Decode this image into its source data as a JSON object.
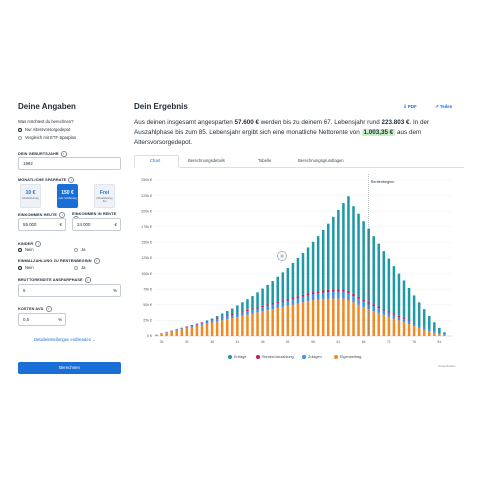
{
  "left": {
    "title": "Deine Angaben",
    "question": "Was möchtest du berechnen?",
    "options": [
      "Nur Altersvorsorgedepot",
      "Vergleich mit ETF-Sparplan"
    ],
    "birth_year_label": "DEIN GEBURTSJAHR",
    "birth_year": "1992",
    "savings_label": "MONATLICHE SPARRATE",
    "savings": [
      {
        "value": "10 €",
        "sub": "Mindestbetrag"
      },
      {
        "value": "150 €",
        "sub": "max. Förderung"
      },
      {
        "value": "Frei",
        "sub": "Monatsbetrag frei"
      }
    ],
    "income_today_label": "EINKOMMEN HEUTE",
    "income_today": "55.000",
    "income_future_label": "EINKOMMEN IN RENTE",
    "income_future": "24.000",
    "currency": "€",
    "children_label": "KINDER",
    "children_options": [
      "Nein",
      "Ja"
    ],
    "payout_label": "EINMALZAHLUNG ZU RENTENBEGINN",
    "payout_options": [
      "Nein",
      "Ja"
    ],
    "return_label": "BRUTTORENDITE ANSPARPHASE",
    "return_value": "6",
    "percent": "%",
    "costs_label": "KOSTEN AVD",
    "costs_value": "0,5",
    "detail_link": "Detaileinstellungen einblenden",
    "calc_button": "Berechnen"
  },
  "right": {
    "title": "Dein Ergebnis",
    "pdf": "PDF",
    "share": "Teilen",
    "summary_parts": [
      "Aus deinen insgesamt angesparten ",
      "57.600 €",
      " werden bis zu deinem 67. Lebensjahr rund ",
      "223.803 €",
      ". In der Auszahlphase bis zum 85. Lebensjahr ergibt sich eine monatliche Nettorente von ",
      "1.003,35 €",
      " aus dem Altersvorsorgedepot."
    ],
    "tabs": [
      "Chart",
      "Berechnungsdetails",
      "Tabelle",
      "Berechnungsgrundlagen"
    ],
    "legend": [
      "Erträge",
      "Steuerrückzahlung",
      "Zulagen",
      "Eigenbeitrag"
    ],
    "retire_label": "Rentenbeginn",
    "footnote": "zinsen/Kosten"
  },
  "colors": {
    "accent": "#1a6fd6",
    "ertraege": "#1e9aa6",
    "steuer": "#c21d56",
    "zulagen": "#3a91e6",
    "eigen": "#f08a24",
    "highlight": "#c9efc6"
  },
  "chart_data": {
    "type": "bar",
    "stacked": true,
    "ylim": [
      0,
      250000
    ],
    "y_ticks": [
      "0 €",
      "25k €",
      "50k €",
      "75k €",
      "100k €",
      "125k €",
      "150k €",
      "175k €",
      "200k €",
      "225k €",
      "250k €"
    ],
    "x_ticks": [
      "26",
      "31",
      "36",
      "41",
      "46",
      "51",
      "56",
      "61",
      "66",
      "71",
      "76",
      "81"
    ],
    "x_start": 25,
    "x_end": 85,
    "retirement_age": 67,
    "series": [
      {
        "name": "Eigenbeitrag",
        "values_note": "accumulation and depletion"
      },
      {
        "name": "Zulagen"
      },
      {
        "name": "Steuerrückzahlung"
      },
      {
        "name": "Erträge"
      }
    ],
    "totals_k": [
      1.5,
      3,
      5,
      7,
      9,
      11,
      13,
      16,
      19,
      22,
      25,
      28,
      32,
      36,
      40,
      44,
      49,
      54,
      59,
      64,
      70,
      76,
      82,
      88,
      95,
      102,
      109,
      117,
      125,
      133,
      142,
      151,
      160,
      170,
      180,
      191,
      202,
      213,
      224,
      208,
      196,
      184,
      172,
      160,
      148,
      136,
      124,
      112,
      100,
      89,
      77,
      65,
      54,
      43,
      32,
      22,
      13,
      6,
      2
    ],
    "eigen_k": [
      1.8,
      3.6,
      5.4,
      7.2,
      9,
      10.8,
      12.6,
      14.4,
      16.2,
      18,
      19.8,
      21.6,
      23.4,
      25.2,
      27,
      28.8,
      30.6,
      32.4,
      34.2,
      36,
      37.8,
      39.6,
      41.4,
      43.2,
      45,
      46.8,
      48.6,
      50.4,
      52.2,
      54,
      55.8,
      57.6,
      58.5,
      59.4,
      60,
      60,
      60,
      60,
      57.6,
      54,
      50,
      46.5,
      43,
      40,
      37,
      34,
      31,
      28,
      25,
      22,
      19,
      16,
      13,
      10,
      7.5,
      5,
      3,
      1.5
    ],
    "zulagen_k": [
      0.3,
      0.6,
      0.9,
      1.2,
      1.5,
      1.8,
      2.1,
      2.4,
      2.7,
      3,
      3.3,
      3.6,
      3.9,
      4.2,
      4.5,
      4.8,
      5.1,
      5.4,
      5.7,
      6,
      6.3,
      6.6,
      6.9,
      7.2,
      7.5,
      7.8,
      8.1,
      8.4,
      8.7,
      9,
      9.3,
      9.6,
      9.9,
      10.2,
      10.5,
      10.8,
      11,
      11,
      10.8,
      10,
      9.5,
      9,
      8.5,
      8,
      7.5,
      7,
      6.5,
      6,
      5.5,
      5,
      4.5,
      4,
      3.5,
      3,
      2.5,
      2,
      1.5,
      1,
      0.5
    ],
    "steuer_k": [
      0.1,
      0.2,
      0.3,
      0.4,
      0.5,
      0.6,
      0.7,
      0.8,
      0.9,
      1,
      1.1,
      1.2,
      1.3,
      1.4,
      1.5,
      1.6,
      1.7,
      1.8,
      1.9,
      2,
      2.1,
      2.2,
      2.3,
      2.4,
      2.5,
      2.6,
      2.7,
      2.8,
      2.9,
      3,
      3.1,
      3.2,
      3.3,
      3.4,
      3.5,
      3.6,
      3.7,
      3.8,
      3.9,
      3.7,
      3.5,
      3.3,
      3.1,
      2.9,
      2.7,
      2.5,
      2.3,
      2.1,
      1.9,
      1.7,
      1.5,
      1.3,
      1.1,
      0.9,
      0.7,
      0.5,
      0.3,
      0.2,
      0.1
    ]
  }
}
